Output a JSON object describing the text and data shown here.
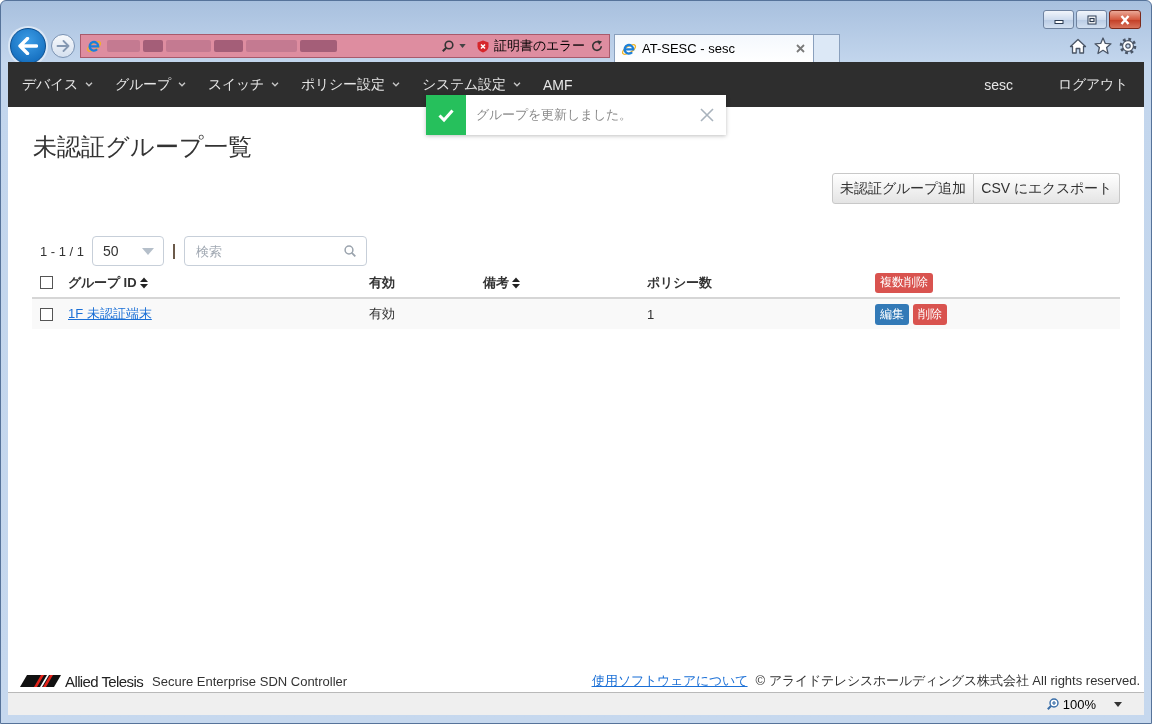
{
  "browser": {
    "certificate_status": "証明書のエラー",
    "tabs": [
      {
        "title": "AT-SESC - sesc",
        "selected": true
      }
    ]
  },
  "navbar": {
    "menus": [
      {
        "label": "デバイス",
        "kind": "dropdown"
      },
      {
        "label": "グループ",
        "kind": "dropdown"
      },
      {
        "label": "スイッチ",
        "kind": "dropdown"
      },
      {
        "label": "ポリシー設定",
        "kind": "dropdown"
      },
      {
        "label": "システム設定",
        "kind": "dropdown"
      },
      {
        "label": "AMF",
        "kind": "link"
      }
    ],
    "user": "sesc",
    "logout": "ログアウト"
  },
  "toast": {
    "kind": "success",
    "message": "グループを更新しました。"
  },
  "page": {
    "title": "未認証グループ一覧",
    "actions": [
      "未認証グループ追加",
      "CSV にエクスポート"
    ]
  },
  "toolbar": {
    "range": "1 - 1 / 1",
    "page_size": "50",
    "search": {
      "placeholder": "検索"
    }
  },
  "table": {
    "select_all": {
      "checked": false
    },
    "columns": [
      {
        "label": "グループ ID",
        "sortable": true
      },
      {
        "label": "有効",
        "sortable": false
      },
      {
        "label": "備考",
        "sortable": true
      },
      {
        "label": "ポリシー数",
        "sortable": false
      }
    ],
    "bulk_action": "複数削除",
    "rows": [
      {
        "checked": false,
        "group_id": "1F 未認証端末",
        "status": "有効",
        "policy_count": "1",
        "actions": [
          {
            "label": "編集",
            "kind": "edit"
          },
          {
            "label": "削除",
            "kind": "delete"
          }
        ]
      }
    ]
  },
  "footer": {
    "brand": "Allied Telesis",
    "product": "Secure Enterprise SDN Controller",
    "link": "使用ソフトウェアについて",
    "copyright": "© アライドテレシスホールディングス株式会社 All rights reserved."
  },
  "status_bar": {
    "zoom": "100%"
  }
}
